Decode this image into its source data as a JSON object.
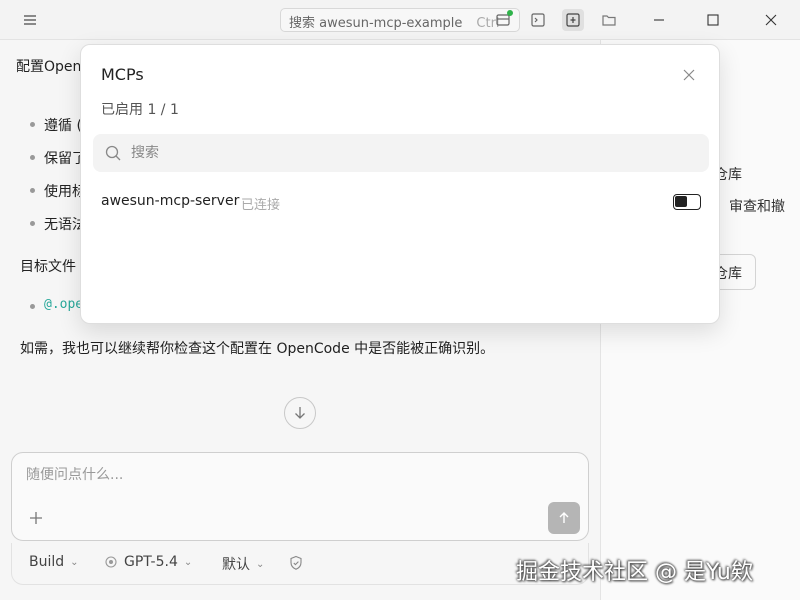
{
  "titlebar": {
    "search_placeholder": "搜索 awesun-mcp-example",
    "search_shortcut": "Ctrl"
  },
  "chat": {
    "heading_fragment": "配置Open",
    "bullets": [
      "遵循 (",
      "保留了",
      "使用标",
      "无语法"
    ],
    "target_label": "目标文件",
    "file_ref": "@.ope",
    "followup": "如需，我也可以继续帮你检查这个配置在 OpenCode 中是否能被正确识别。"
  },
  "composer": {
    "placeholder": "随便问点什么...",
    "agent_label": "Build",
    "model_label": "GPT-5.4",
    "variant_label": "默认"
  },
  "right_panel": {
    "fragment1": "仓库",
    "fragment2": "审查和撤",
    "button_fragment": "仓库"
  },
  "modal": {
    "title": "MCPs",
    "enabled_summary": "已启用 1 / 1",
    "search_placeholder": "搜索",
    "servers": [
      {
        "name": "awesun-mcp-server",
        "status": "已连接",
        "enabled": true
      }
    ]
  },
  "watermark": "掘金技术社区 @ 是Yu欸",
  "colors": {
    "accent_green": "#2fb34a",
    "code_teal": "#27a89a"
  }
}
